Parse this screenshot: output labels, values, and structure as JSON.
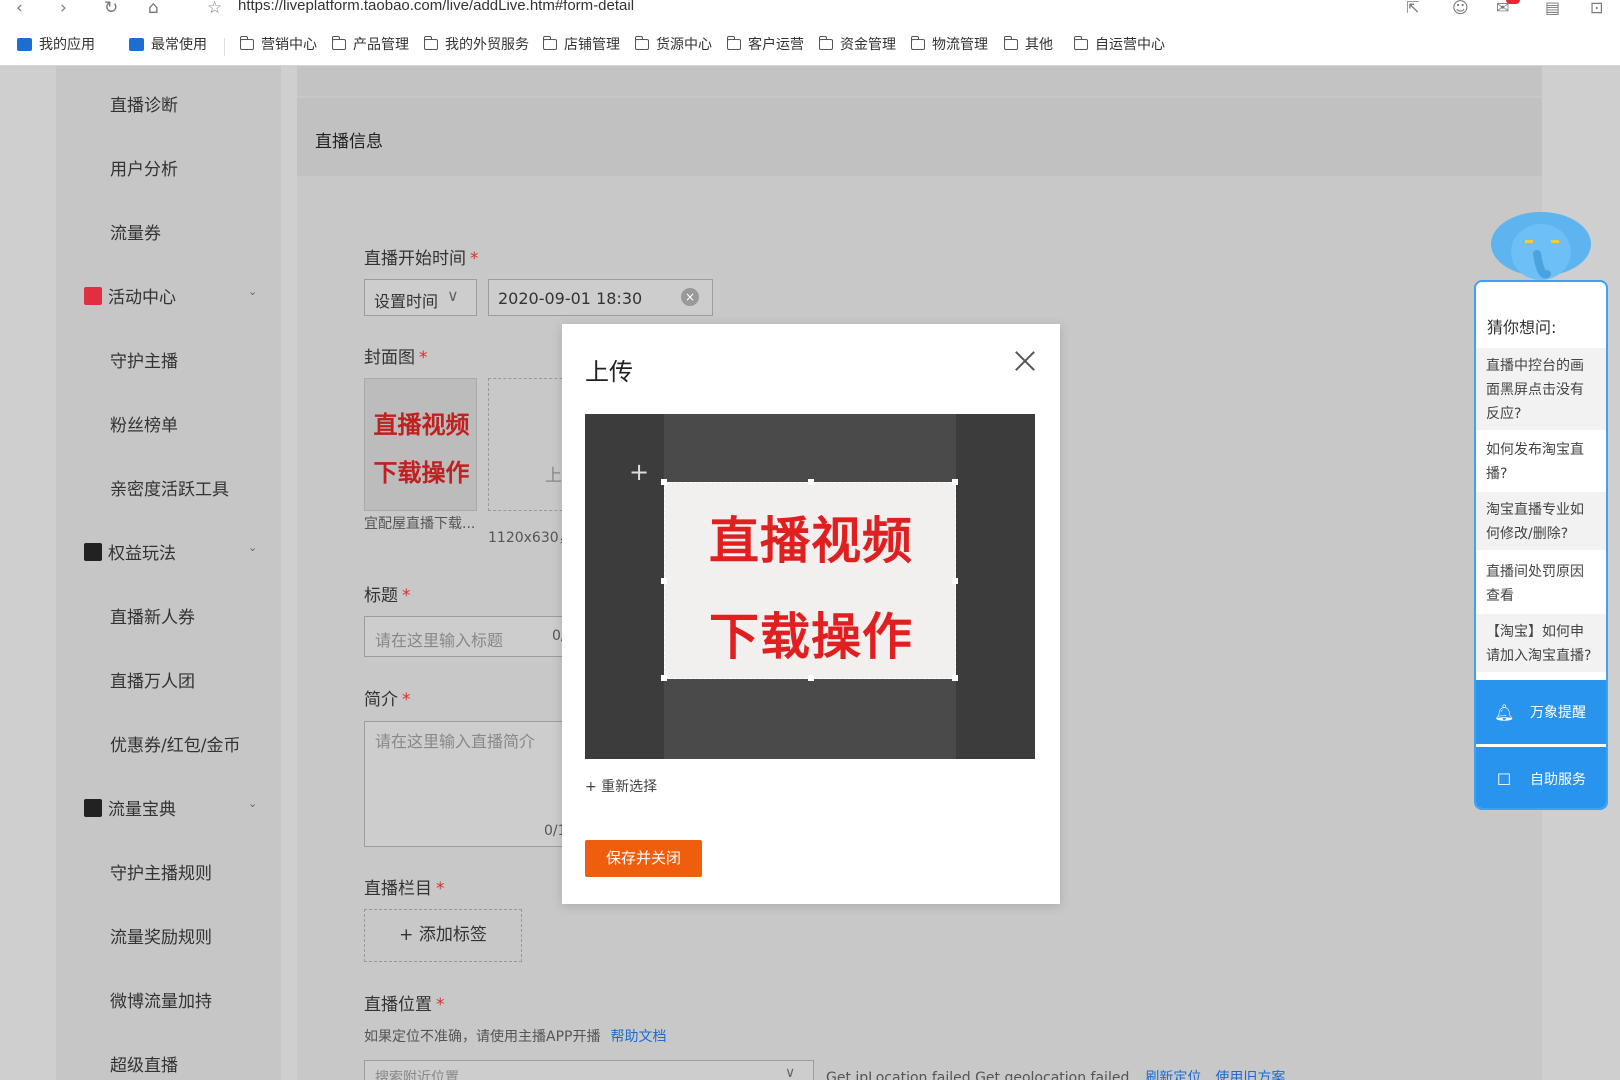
{
  "browser": {
    "url": "https://liveplatform.taobao.com/live/addLive.htm#form-detail",
    "back": "‹",
    "forward": "›",
    "reload": "↻",
    "bookmarks": [
      {
        "label": "我的应用"
      },
      {
        "label": "最常使用"
      },
      {
        "label": "营销中心"
      },
      {
        "label": "产品管理"
      },
      {
        "label": "我的外贸服务"
      },
      {
        "label": "店铺管理"
      },
      {
        "label": "货源中心"
      },
      {
        "label": "客户运营"
      },
      {
        "label": "资金管理"
      },
      {
        "label": "物流管理"
      },
      {
        "label": "其他"
      },
      {
        "label": "自运营中心"
      }
    ]
  },
  "sidebar": {
    "items": [
      {
        "label": "直播诊断"
      },
      {
        "label": "用户分析"
      },
      {
        "label": "流量券"
      },
      {
        "label": "活动中心",
        "icon": "activity-icon"
      },
      {
        "label": "守护主播"
      },
      {
        "label": "粉丝榜单"
      },
      {
        "label": "亲密度活跃工具"
      },
      {
        "label": "权益玩法",
        "icon": "rights-icon"
      },
      {
        "label": "直播新人券"
      },
      {
        "label": "直播万人团"
      },
      {
        "label": "优惠券/红包/金币"
      },
      {
        "label": "流量宝典",
        "icon": "trend-icon"
      },
      {
        "label": "守护主播规则"
      },
      {
        "label": "流量奖励规则"
      },
      {
        "label": "微博流量加持"
      },
      {
        "label": "超级直播"
      }
    ]
  },
  "form": {
    "section_title": "直播信息",
    "start_time": {
      "label": "直播开始时间",
      "required": "*",
      "mode": "设置时间",
      "value": "2020-09-01 18:30"
    },
    "cover": {
      "label": "封面图",
      "required": "*",
      "thumb_line1": "直播视频",
      "thumb_line2": "下载操作",
      "thumb_caption": "宜配屋直播下载...",
      "upload_hint_partial": "上",
      "size_hint": "1120x630，"
    },
    "title": {
      "label": "标题",
      "required": "*",
      "placeholder": "请在这里输入标题",
      "counter": "0/"
    },
    "intro": {
      "label": "简介",
      "required": "*",
      "placeholder": "请在这里输入直播简介",
      "counter": "0/1"
    },
    "column": {
      "label": "直播栏目",
      "required": "*",
      "add_tag": "+ 添加标签"
    },
    "location": {
      "label": "直播位置",
      "required": "*",
      "hint": "如果定位不准确，请使用主播APP开播",
      "help_link": "帮助文档",
      "search_placeholder": "搜索附近位置",
      "error": "Get ipLocation failed,Get geolocation failed",
      "refresh": "刷新定位",
      "old_plan": "使用旧方案"
    }
  },
  "modal": {
    "title": "上传",
    "image_line1": "直播视频",
    "image_line2": "下载操作",
    "reselect": "+ 重新选择",
    "save_close": "保存并关闭"
  },
  "assistant": {
    "ask_title": "猜你想问:",
    "questions": [
      "直播中控台的画面黑屏点击没有反应?",
      "如何发布淘宝直播?",
      "淘宝直播专业如何修改/删除?",
      "直播间处罚原因查看",
      "【淘宝】如何申请加入淘宝直播?"
    ],
    "remind": "万象提醒",
    "self_service": "自助服务"
  },
  "colors": {
    "accent_orange": "#ee5e0c",
    "assistant_blue": "#2994ee",
    "required_red": "#d9302d",
    "link_blue": "#1d6ad0"
  }
}
